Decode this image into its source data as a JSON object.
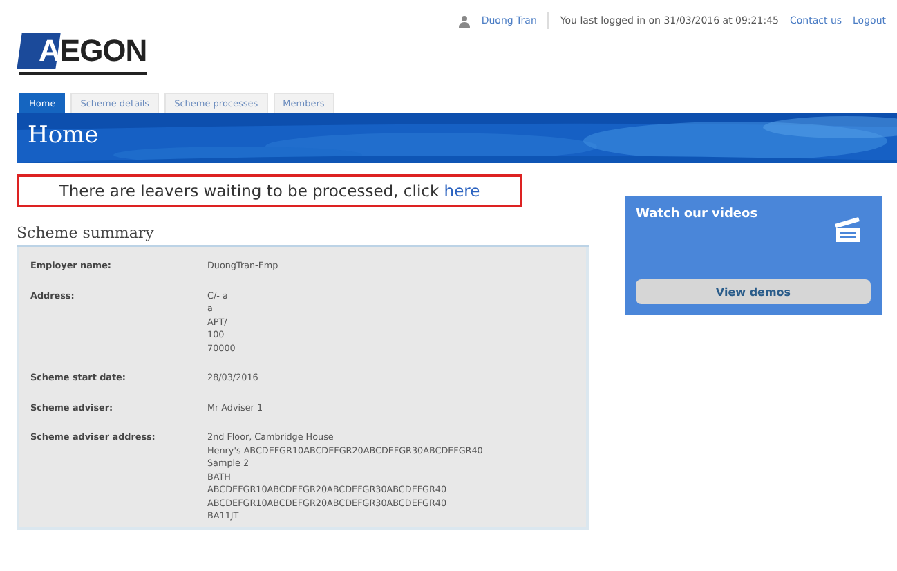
{
  "header": {
    "logo": "AEGON",
    "user": "Duong Tran",
    "last_login": "You last logged in on 31/03/2016 at 09:21:45",
    "links": [
      "Contact us",
      "Logout"
    ]
  },
  "tabs": [
    {
      "label": "Home",
      "selected": true
    },
    {
      "label": "Scheme details",
      "selected": false
    },
    {
      "label": "Scheme processes",
      "selected": false
    },
    {
      "label": "Members",
      "selected": false
    }
  ],
  "page_title": "Home",
  "alert": {
    "text": "There are leavers waiting to be processed, click ",
    "link": "here"
  },
  "summary": {
    "title": "Scheme summary",
    "rows": [
      {
        "label": "Employer name:",
        "lines": [
          "DuongTran-Emp"
        ]
      },
      {
        "label": "Address:",
        "lines": [
          "C/- a",
          "a",
          "APT/",
          "100",
          "70000"
        ]
      },
      {
        "label": "Scheme start date:",
        "lines": [
          "28/03/2016"
        ]
      },
      {
        "label": "Scheme adviser:",
        "lines": [
          "Mr Adviser 1"
        ]
      },
      {
        "label": "Scheme adviser address:",
        "lines": [
          "2nd Floor, Cambridge House",
          "Henry's ABCDEFGR10ABCDEFGR20ABCDEFGR30ABCDEFGR40",
          "Sample 2",
          "BATH",
          "ABCDEFGR10ABCDEFGR20ABCDEFGR30ABCDEFGR40",
          "ABCDEFGR10ABCDEFGR20ABCDEFGR30ABCDEFGR40",
          "BA11JT"
        ]
      }
    ]
  },
  "videos": {
    "title": "Watch our videos",
    "button": "View demos"
  }
}
